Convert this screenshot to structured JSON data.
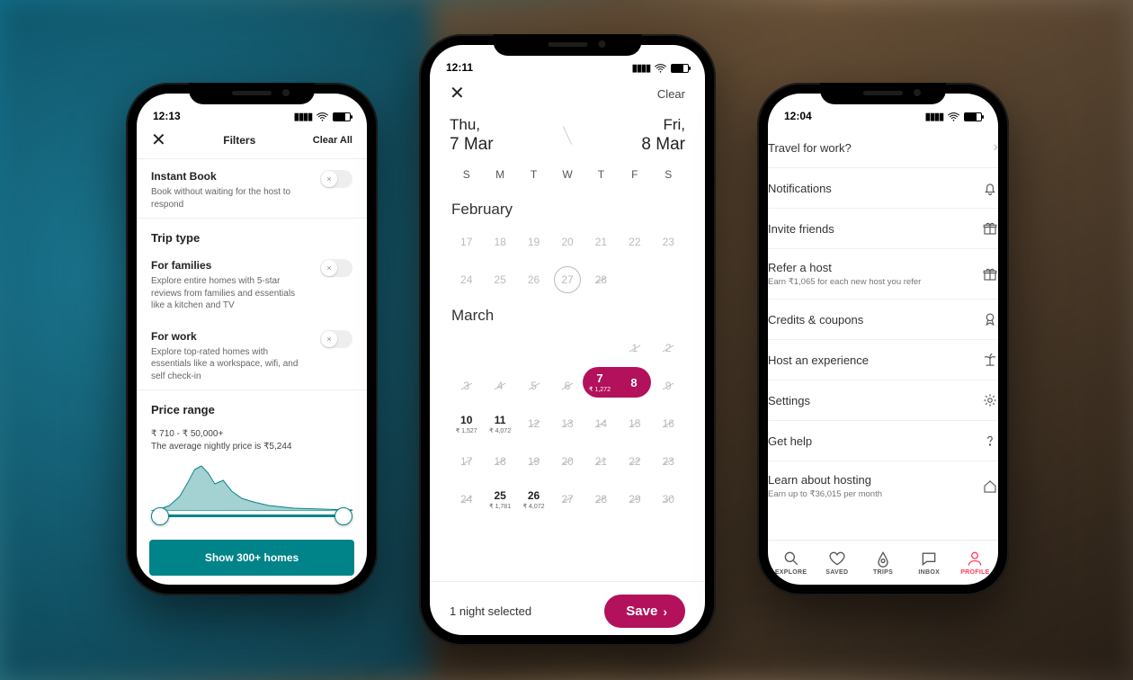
{
  "accent_teal": "#008489",
  "accent_magenta": "#b3115b",
  "accent_coral": "#ff385c",
  "filters": {
    "time": "12:13",
    "header": {
      "title": "Filters",
      "clear": "Clear All"
    },
    "instant": {
      "title": "Instant Book",
      "desc": "Book without waiting for the host to respond"
    },
    "trip_section": "Trip type",
    "trip_families": {
      "title": "For families",
      "desc": "Explore entire homes with 5-star reviews from families and essentials like a kitchen and TV"
    },
    "trip_work": {
      "title": "For work",
      "desc": "Explore top-rated homes with essentials like a workspace, wifi, and self check-in"
    },
    "price_section": "Price range",
    "price_range": "₹ 710 - ₹ 50,000+",
    "price_avg": "The average nightly price is ₹5,244",
    "cta": "Show 300+ homes"
  },
  "dates": {
    "time": "12:11",
    "clear": "Clear",
    "from_dow": "Thu,",
    "from_date": "7 Mar",
    "to_dow": "Fri,",
    "to_date": "8 Mar",
    "dow": [
      "S",
      "M",
      "T",
      "W",
      "T",
      "F",
      "S"
    ],
    "month1": "February",
    "month2": "March",
    "sel_start_day": "7",
    "sel_start_price": "₹ 1,272",
    "sel_end_day": "8",
    "nights": "1 night selected",
    "save": "Save",
    "feb_row1": [
      "17",
      "18",
      "19",
      "20",
      "21",
      "22",
      "23"
    ],
    "feb_row2": [
      "24",
      "25",
      "26",
      "27",
      "28"
    ],
    "mar_prices": {
      "10": "₹ 1,527",
      "11": "₹ 4,072",
      "25": "₹ 1,781",
      "26": "₹ 4,072"
    }
  },
  "profile": {
    "time": "12:04",
    "items": {
      "travel": {
        "label": "Travel for work?"
      },
      "notif": {
        "label": "Notifications"
      },
      "invite": {
        "label": "Invite friends"
      },
      "refer": {
        "label": "Refer a host",
        "sub": "Earn ₹1,065 for each new host you refer"
      },
      "credits": {
        "label": "Credits & coupons"
      },
      "hostexp": {
        "label": "Host an experience"
      },
      "settings": {
        "label": "Settings"
      },
      "help": {
        "label": "Get help"
      },
      "learn": {
        "label": "Learn about hosting",
        "sub": "Earn up to ₹36,015 per month"
      }
    },
    "tabs": {
      "explore": "EXPLORE",
      "saved": "SAVED",
      "trips": "TRIPS",
      "inbox": "INBOX",
      "profile": "PROFILE"
    }
  }
}
